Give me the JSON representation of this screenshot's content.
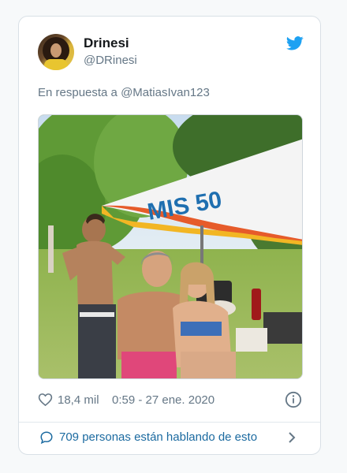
{
  "tweet": {
    "display_name": "Drinesi",
    "handle": "@DRinesi",
    "reply_prefix": "En respuesta a",
    "reply_mention": "@MatiasIvan123",
    "photo_sign_text": "MIS 50",
    "likes": "18,4 mil",
    "timestamp": "0:59 - 27 ene. 2020",
    "talking": "709 personas están hablando de esto"
  },
  "icons": {
    "brand": "twitter-bird-icon",
    "like": "heart-icon",
    "info": "info-icon",
    "talking": "speech-bubble-icon",
    "more": "chevron-right-icon"
  },
  "colors": {
    "brand_blue": "#1da1f2",
    "link_blue": "#1b6aa0",
    "muted": "#657786",
    "text": "#14171a"
  }
}
